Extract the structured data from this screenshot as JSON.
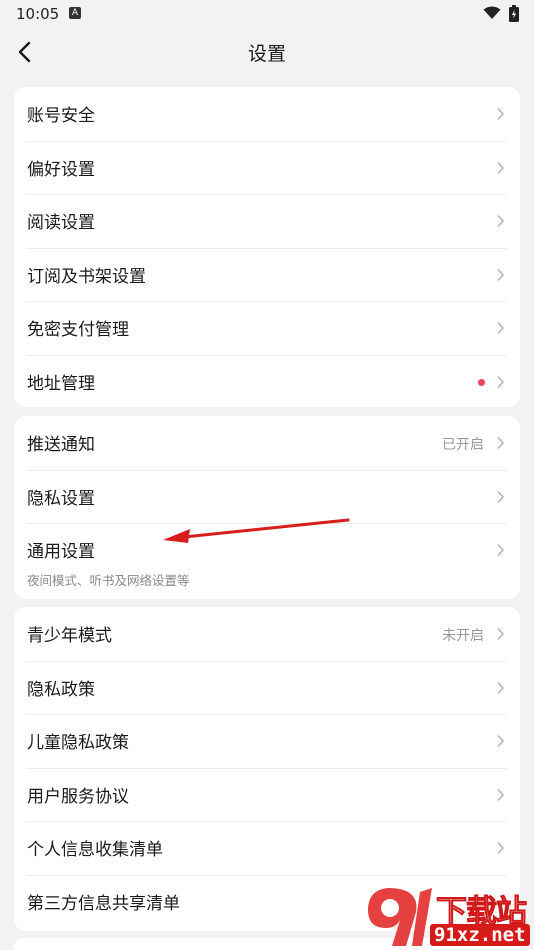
{
  "status": {
    "time": "10:05"
  },
  "header": {
    "title": "设置"
  },
  "groups": [
    {
      "rows": [
        {
          "label": "账号安全"
        },
        {
          "label": "偏好设置"
        },
        {
          "label": "阅读设置"
        },
        {
          "label": "订阅及书架设置"
        },
        {
          "label": "免密支付管理"
        },
        {
          "label": "地址管理",
          "badge": "red-dot"
        }
      ]
    },
    {
      "rows": [
        {
          "label": "推送通知",
          "value": "已开启"
        },
        {
          "label": "隐私设置"
        },
        {
          "label": "通用设置",
          "subtitle": "夜间模式、听书及网络设置等"
        }
      ]
    },
    {
      "rows": [
        {
          "label": "青少年模式",
          "value": "未开启"
        },
        {
          "label": "隐私政策"
        },
        {
          "label": "儿童隐私政策"
        },
        {
          "label": "用户服务协议"
        },
        {
          "label": "个人信息收集清单"
        },
        {
          "label": "第三方信息共享清单"
        }
      ]
    }
  ],
  "watermark": {
    "brand": "下载站",
    "domain": "91xz.net"
  },
  "colors": {
    "background": "#f2f2f4",
    "card": "#ffffff",
    "dot": "#f0455a",
    "annotation_arrow": "#d91c1c"
  }
}
